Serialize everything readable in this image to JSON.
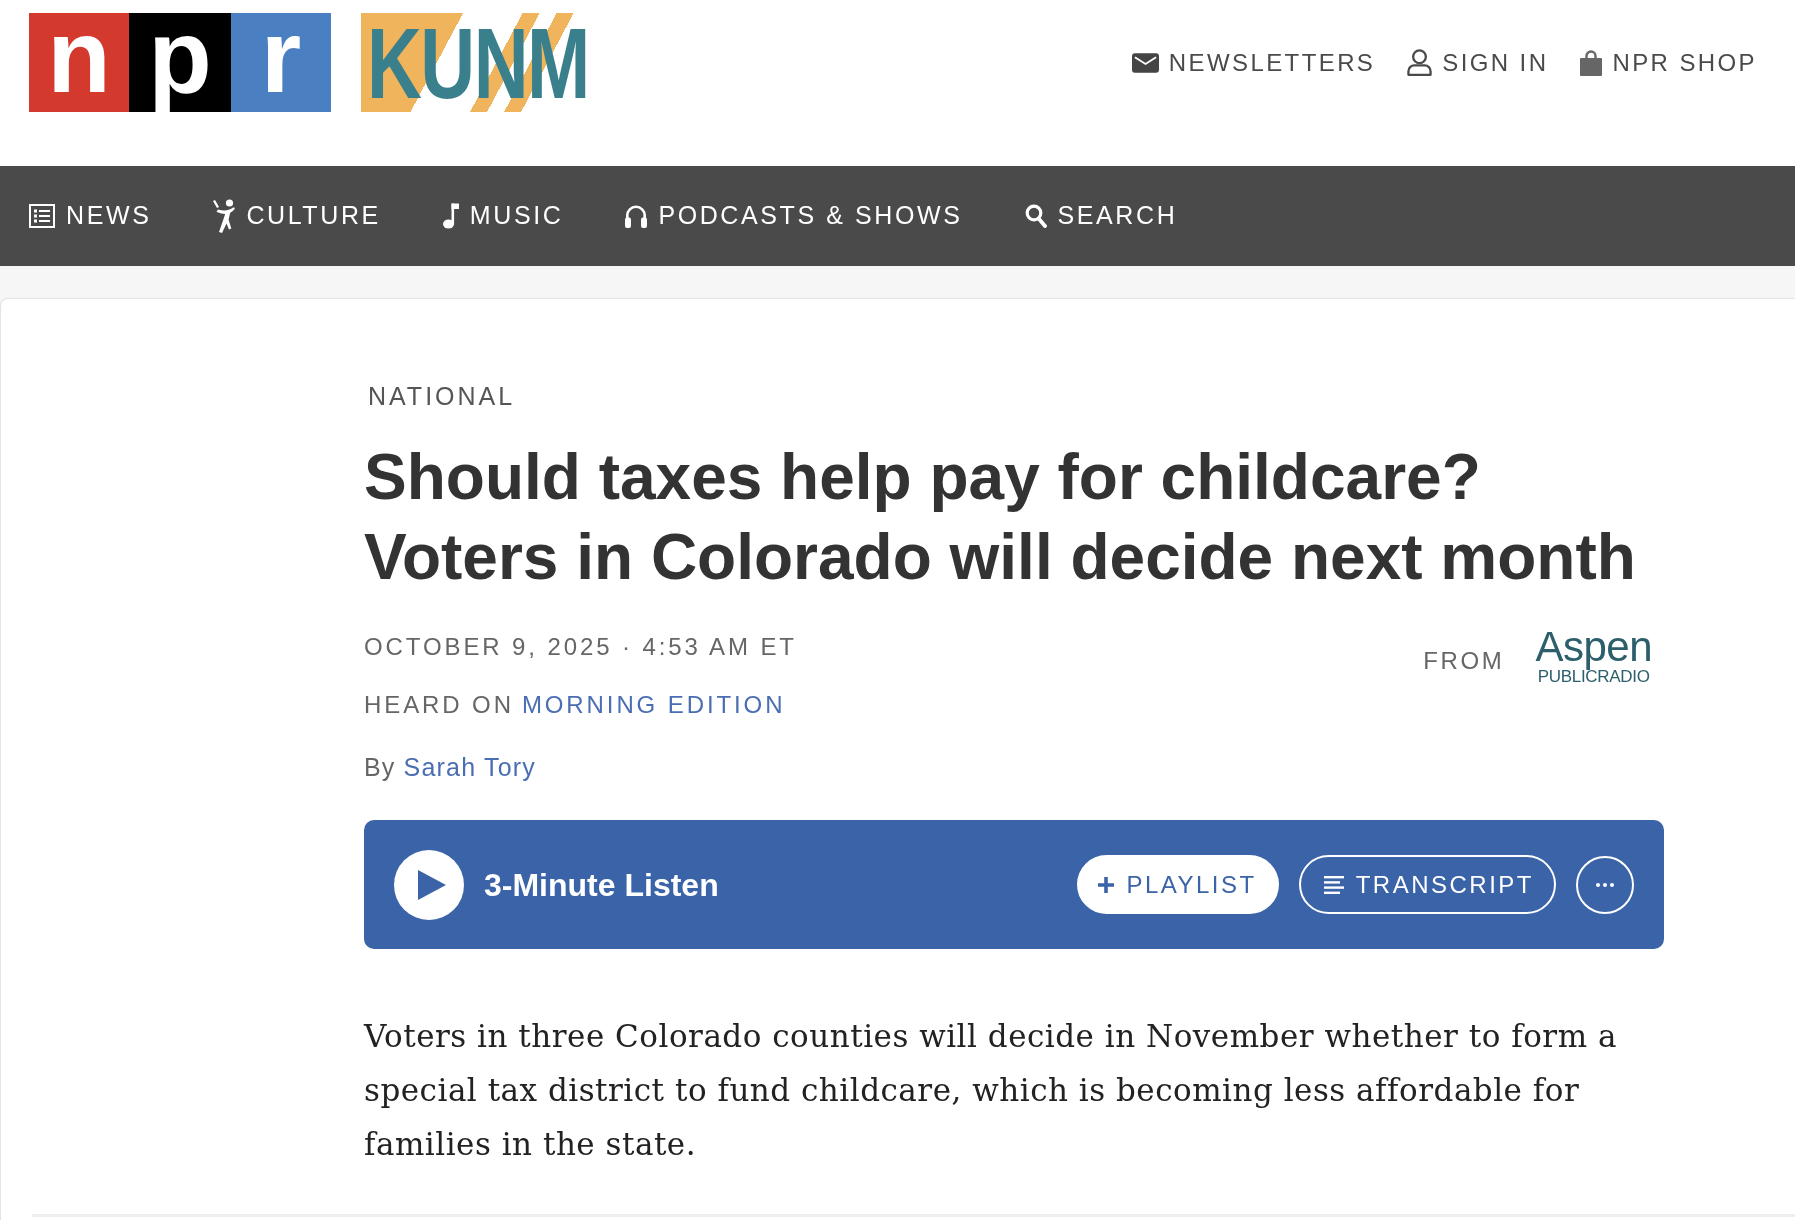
{
  "header": {
    "npr_logo": {
      "tiles": [
        {
          "letter": "n",
          "color": "#d3392d"
        },
        {
          "letter": "p",
          "color": "#000000"
        },
        {
          "letter": "r",
          "color": "#4a80c1"
        }
      ]
    },
    "station_logo": {
      "text": "KUNM"
    },
    "utility_links": [
      {
        "kind": "newsletters",
        "label": "NEWSLETTERS"
      },
      {
        "kind": "sign_in",
        "label": "SIGN IN"
      },
      {
        "kind": "shop",
        "label": "NPR SHOP"
      }
    ]
  },
  "main_nav": {
    "items": [
      {
        "kind": "news",
        "label": "NEWS"
      },
      {
        "kind": "culture",
        "label": "CULTURE"
      },
      {
        "kind": "music",
        "label": "MUSIC"
      },
      {
        "kind": "podcasts",
        "label": "PODCASTS & SHOWS"
      },
      {
        "kind": "search",
        "label": "SEARCH"
      }
    ]
  },
  "article": {
    "section": "NATIONAL",
    "title": "Should taxes help pay for childcare? Voters in Colorado will decide next month",
    "dateline": "OCTOBER 9, 2025 · 4:53 AM ET",
    "heard_on": {
      "label": "HEARD ON",
      "program": "MORNING EDITION"
    },
    "byline": {
      "label": "By",
      "author": "Sarah Tory"
    },
    "source": {
      "label": "FROM",
      "logo": {
        "name": "Aspen",
        "tagline": "PUBLICRADIO"
      }
    },
    "audio_player": {
      "title": "3-Minute Listen",
      "actions": [
        {
          "kind": "playlist",
          "label": "PLAYLIST"
        },
        {
          "kind": "transcript",
          "label": "TRANSCRIPT"
        },
        {
          "kind": "more"
        }
      ]
    },
    "body": [
      "Voters in three Colorado counties will decide in November whether to form a special tax district to fund childcare, which is becoming less affordable for families in the state."
    ]
  }
}
